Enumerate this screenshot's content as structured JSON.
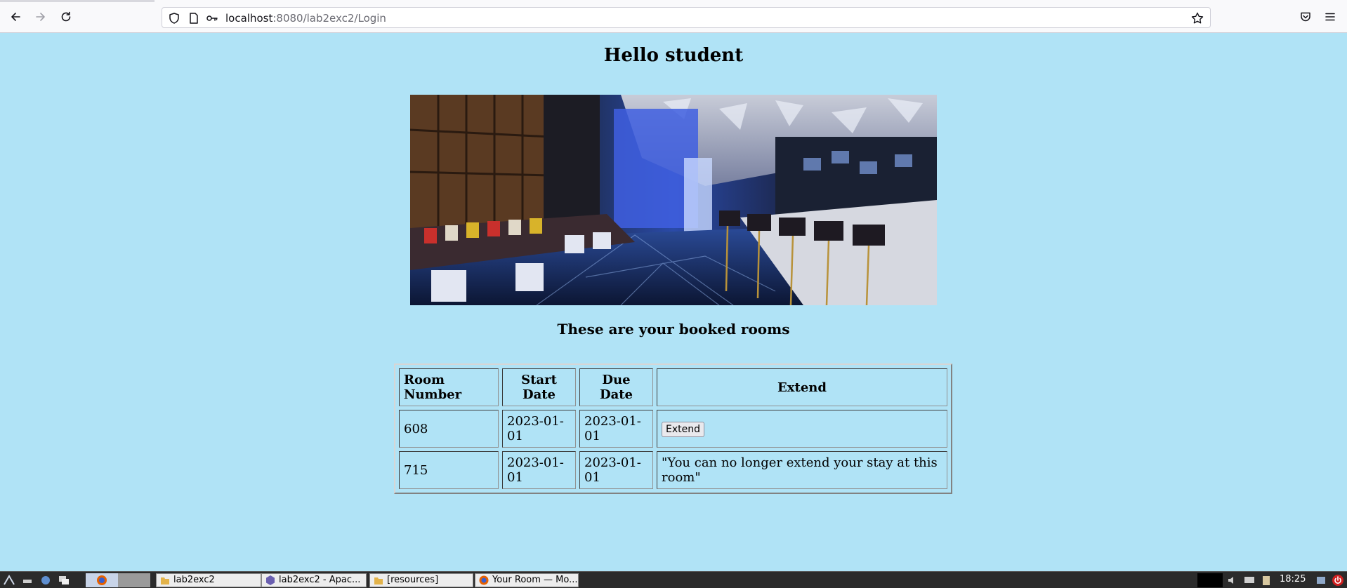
{
  "browser": {
    "url_host": "localhost",
    "url_rest": ":8080/lab2exc2/Login"
  },
  "page": {
    "greeting": "Hello student",
    "subtitle": "These are your booked rooms"
  },
  "table": {
    "headers": [
      "Room Number",
      "Start Date",
      "Due Date",
      "Extend"
    ],
    "rows": [
      {
        "room": "608",
        "start": "2023-01-01",
        "due": "2023-01-01",
        "extend_label": "Extend",
        "extend_text": ""
      },
      {
        "room": "715",
        "start": "2023-01-01",
        "due": "2023-01-01",
        "extend_label": "",
        "extend_text": "\"You can no longer extend your stay at this room\""
      }
    ]
  },
  "taskbar": {
    "tasks": [
      "lab2exc2",
      "lab2exc2 - Apac...",
      "[resources]",
      "Your Room — Mo..."
    ],
    "clock": "18:25"
  },
  "colors": {
    "page_background": "#b0e3f6",
    "chrome_background": "#f9f9fb",
    "taskbar_background": "#2b2b2b"
  },
  "icons": [
    "back-arrow-icon",
    "forward-arrow-icon",
    "reload-icon",
    "shield-icon",
    "page-icon",
    "key-icon",
    "bookmark-star-icon",
    "pocket-icon",
    "menu-icon",
    "firefox-icon",
    "folder-icon",
    "eclipse-icon"
  ]
}
